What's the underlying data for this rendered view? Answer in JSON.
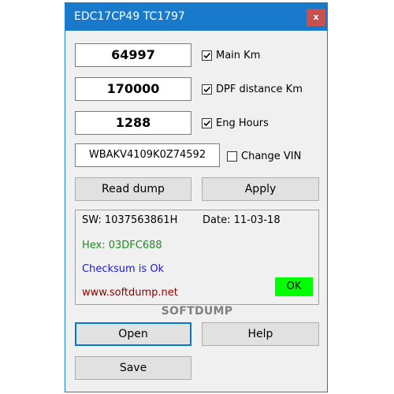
{
  "window": {
    "title": "EDC17CP49 TC1797",
    "close_label": "x"
  },
  "fields": {
    "main_km": {
      "value": "64997",
      "label": "Main Km",
      "checked": true
    },
    "dpf_km": {
      "value": "170000",
      "label": "DPF distance Km",
      "checked": true
    },
    "eng_hours": {
      "value": "1288",
      "label": "Eng Hours",
      "checked": true
    },
    "vin": {
      "value": "WBAKV4109K0Z74592",
      "label": "Change VIN",
      "checked": false
    }
  },
  "buttons": {
    "read_dump": "Read dump",
    "apply": "Apply",
    "open": "Open",
    "help": "Help",
    "save": "Save"
  },
  "info": {
    "sw": "SW: 1037563861H",
    "date": "Date: 11-03-18",
    "hex": "Hex: 03DFC688",
    "checksum": "Checksum is Ok",
    "website": "www.softdump.net",
    "status": "OK"
  },
  "brand": "SOFTDUMP",
  "colors": {
    "titlebar": "#1979ca",
    "close": "#c75050",
    "hex_text": "#228b22",
    "checksum_text": "#1a1acd",
    "website_text": "#8b0000",
    "ok_badge": "#00ff00",
    "brand_text": "#808080"
  }
}
